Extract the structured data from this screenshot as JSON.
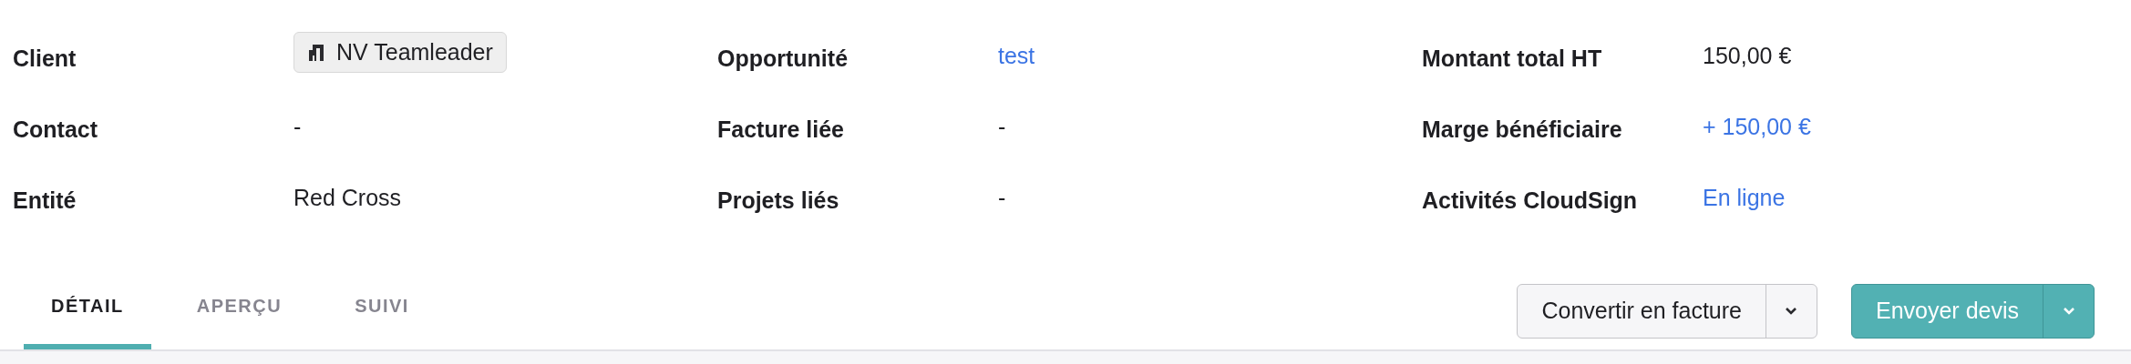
{
  "fields": [
    {
      "label": "Client",
      "value": "NV Teamleader",
      "kind": "chip"
    },
    {
      "label": "Opportunité",
      "value": "test",
      "kind": "link"
    },
    {
      "label": "Montant total HT",
      "value": "150,00 €",
      "kind": "text"
    },
    {
      "label": "Contact",
      "value": "-",
      "kind": "text"
    },
    {
      "label": "Facture liée",
      "value": "-",
      "kind": "text"
    },
    {
      "label": "Marge bénéficiaire",
      "value": "+ 150,00 €",
      "kind": "link"
    },
    {
      "label": "Entité",
      "value": "Red Cross",
      "kind": "text"
    },
    {
      "label": "Projets liés",
      "value": "-",
      "kind": "text"
    },
    {
      "label": "Activités CloudSign",
      "value": "En ligne",
      "kind": "link"
    }
  ],
  "tabs": [
    {
      "label": "DÉTAIL",
      "selected": true
    },
    {
      "label": "APERÇU",
      "selected": false
    },
    {
      "label": "SUIVI",
      "selected": false
    }
  ],
  "actions": [
    {
      "label": "Convertir en facture",
      "kind": "secondary"
    },
    {
      "label": "Envoyer devis",
      "kind": "primary"
    }
  ]
}
